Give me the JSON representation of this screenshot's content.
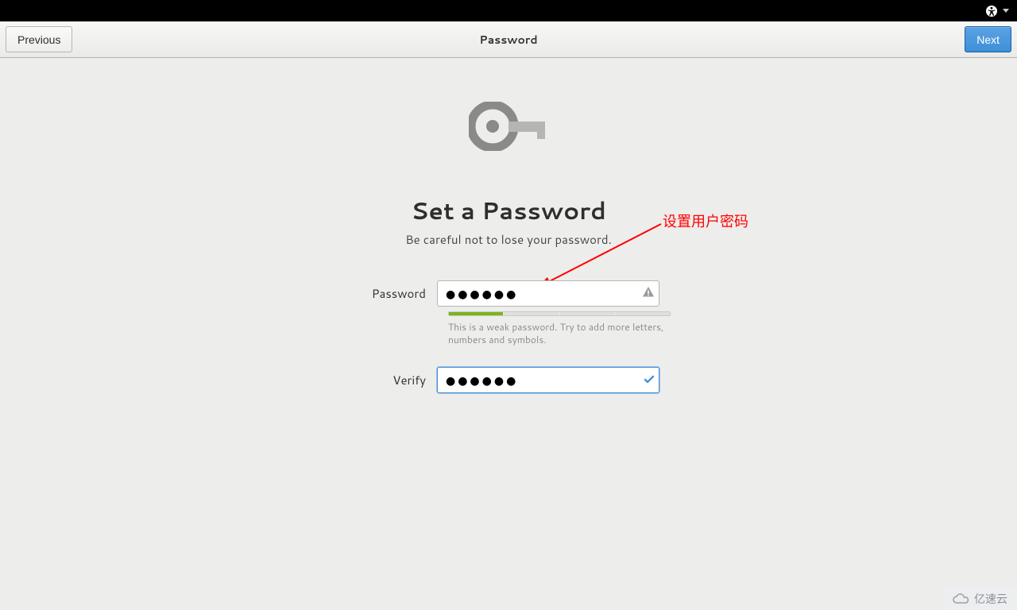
{
  "topbar": {
    "a11y_icon": "accessibility-icon"
  },
  "header": {
    "previous_label": "Previous",
    "title": "Password",
    "next_label": "Next"
  },
  "page": {
    "heading": "Set a Password",
    "subheading": "Be careful not to lose your password."
  },
  "annotation": {
    "text": "设置用户密码"
  },
  "form": {
    "password_label": "Password",
    "password_value": "●●●●●●",
    "password_hint": "This is a weak password. Try to add more letters, numbers and symbols.",
    "verify_label": "Verify",
    "verify_value": "●●●●●●",
    "strength_segments": 4,
    "strength_filled": 1
  },
  "watermark": {
    "text": "亿速云"
  }
}
